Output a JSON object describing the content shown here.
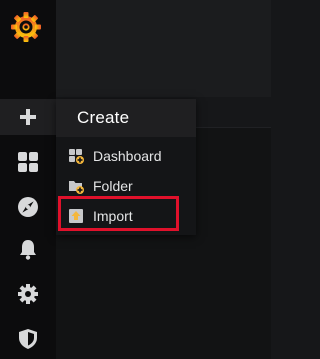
{
  "sidenav": {
    "logo_icon": "grafana-logo-icon",
    "items": [
      {
        "icon": "plus-icon",
        "active": true
      },
      {
        "icon": "dashboards-grid-icon",
        "active": false
      },
      {
        "icon": "compass-explore-icon",
        "active": false
      },
      {
        "icon": "bell-alerting-icon",
        "active": false
      },
      {
        "icon": "gear-configuration-icon",
        "active": false
      },
      {
        "icon": "shield-admin-icon",
        "active": false
      }
    ]
  },
  "create_menu": {
    "title": "Create",
    "items": [
      {
        "label": "Dashboard",
        "icon": "dashboard-add-icon"
      },
      {
        "label": "Folder",
        "icon": "folder-add-icon"
      },
      {
        "label": "Import",
        "icon": "import-icon",
        "highlighted": true
      }
    ]
  },
  "colors": {
    "highlight_border": "#e0112b",
    "logo_orange": "#f46800",
    "accent_yellow": "#f5b73b"
  }
}
